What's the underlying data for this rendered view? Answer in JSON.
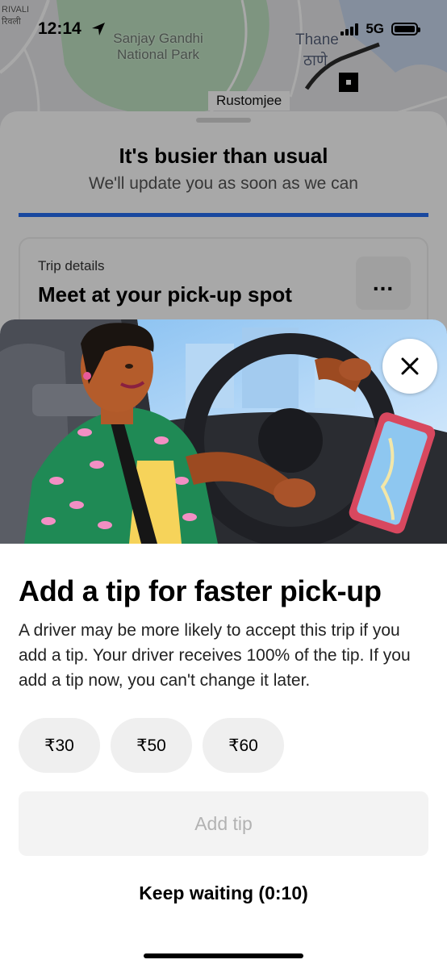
{
  "status_bar": {
    "time": "12:14",
    "network": "5G",
    "icons": [
      "location-arrow-icon",
      "signal-icon",
      "battery-icon"
    ]
  },
  "map": {
    "labels": {
      "rivali_en": "RIVALI",
      "rivali_local": "रिवली",
      "park": "Sanjay Gandhi National Park",
      "city_en": "Thane",
      "city_local": "ठाणे",
      "place": "Rustomjee"
    }
  },
  "sheet": {
    "title": "It's busier than usual",
    "subtitle": "We'll update you as soon as we can",
    "progress_fraction": 1.0,
    "trip": {
      "label": "Trip details",
      "title": "Meet at your pick-up spot",
      "more_label": "..."
    }
  },
  "modal": {
    "close_icon": "close-icon",
    "title": "Add a tip for faster pick-up",
    "body": "A driver may be more likely to accept this trip if you add a tip. Your driver receives 100% of the tip. If you add a tip now, you can't change it later.",
    "tip_options": [
      {
        "label": "₹30"
      },
      {
        "label": "₹50"
      },
      {
        "label": "₹60"
      }
    ],
    "add_tip_label": "Add tip",
    "keep_waiting_label": "Keep waiting (0:10)"
  },
  "colors": {
    "accent": "#276ef1",
    "disabled_text": "#b2b2b2",
    "chip_bg": "#efefef"
  }
}
